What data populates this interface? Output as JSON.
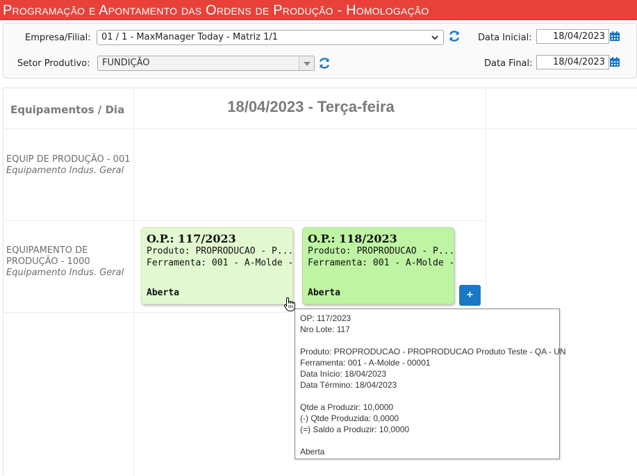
{
  "window": {
    "title": "Programação e Apontamento das Ordens de Produção  - Homologação"
  },
  "filters": {
    "company_label": "Empresa/Filial:",
    "company_value": "01 / 1 - MaxManager Today - Matriz 1/1",
    "sector_label": "Setor Produtivo:",
    "sector_value": "FUNDIÇÃO",
    "start_label": "Data Inicial:",
    "start_value": "18/04/2023",
    "end_label": "Data Final:",
    "end_value": "18/04/2023"
  },
  "grid": {
    "header_equipment": "Equipamentos / Dia",
    "header_date": "18/04/2023 - Terça-feira",
    "equipment": [
      {
        "name": "EQUIP DE PRODUÇÃO - 001",
        "type": "Equipamento Indus. Geral"
      },
      {
        "name": "EQUIPAMENTO DE PRODUÇÃO - 1000",
        "type": "Equipamento Indus. Geral"
      }
    ]
  },
  "orders": [
    {
      "op": "O.P.: 117/2023",
      "product": "Produto: PROPRODUCAO - P...",
      "tool": "Ferramenta: 001 - A-Molde -...",
      "status": "Aberta",
      "color": "#e2f8d0"
    },
    {
      "op": "O.P.: 118/2023",
      "product": "Produto: PROPRODUCAO - P...",
      "tool": "Ferramenta: 001 - A-Molde -...",
      "status": "Aberta",
      "color": "#bff4a4"
    }
  ],
  "add_button_label": "+",
  "tooltip": {
    "op": "OP: 117/2023",
    "lot": "Nro Lote: 117",
    "product": "Produto: PROPRODUCAO - PROPRODUCAO Produto Teste - QA - UN",
    "tool": "Ferramenta: 001 - A-Molde - 00001",
    "start": "Data Início: 18/04/2023",
    "end": "Data Término: 18/04/2023",
    "qty": "Qtde a Produzir: 10,0000",
    "produced": "(-) Qtde Produzida: 0,0000",
    "balance": "(=) Saldo a Produzir: 10,0000",
    "status": "Aberta"
  },
  "colors": {
    "titlebar": "#e8413a",
    "accent": "#1b78c6",
    "refresh_icon": "#1b78c6"
  },
  "icons": {
    "refresh": "refresh-icon",
    "calendar": "calendar-icon",
    "cursor": "hand-cursor-icon"
  }
}
